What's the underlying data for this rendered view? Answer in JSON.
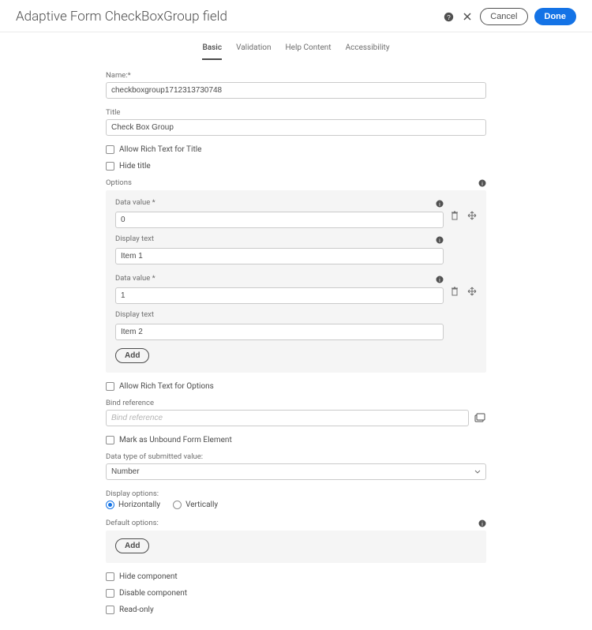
{
  "header": {
    "title": "Adaptive Form CheckBoxGroup field",
    "cancel": "Cancel",
    "done": "Done"
  },
  "tabs": [
    "Basic",
    "Validation",
    "Help Content",
    "Accessibility"
  ],
  "activeTab": 0,
  "basic": {
    "nameLabel": "Name:",
    "nameReq": "*",
    "nameValue": "checkboxgroup1712313730748",
    "titleLabel": "Title",
    "titleValue": "Check Box Group",
    "richTextTitle": "Allow Rich Text for Title",
    "hideTitle": "Hide title",
    "optionsLabel": "Options",
    "options": [
      {
        "dataValueLabel": "Data value *",
        "dataValue": "0",
        "displayTextLabel": "Display text",
        "displayText": "Item 1"
      },
      {
        "dataValueLabel": "Data value *",
        "dataValue": "1",
        "displayTextLabel": "Display text",
        "displayText": "Item 2"
      }
    ],
    "addLabel": "Add",
    "richTextOptions": "Allow Rich Text for Options",
    "bindRefLabel": "Bind reference",
    "bindRefPlaceholder": "Bind reference",
    "markUnbound": "Mark as Unbound Form Element",
    "dataTypeLabel": "Data type of submitted value:",
    "dataTypeValue": "Number",
    "displayOptionsLabel": "Display options:",
    "displayHorizontally": "Horizontally",
    "displayVertically": "Vertically",
    "displaySelected": "horizontally",
    "defaultOptionsLabel": "Default options:",
    "hideComponent": "Hide component",
    "disableComponent": "Disable component",
    "readOnly": "Read-only"
  }
}
